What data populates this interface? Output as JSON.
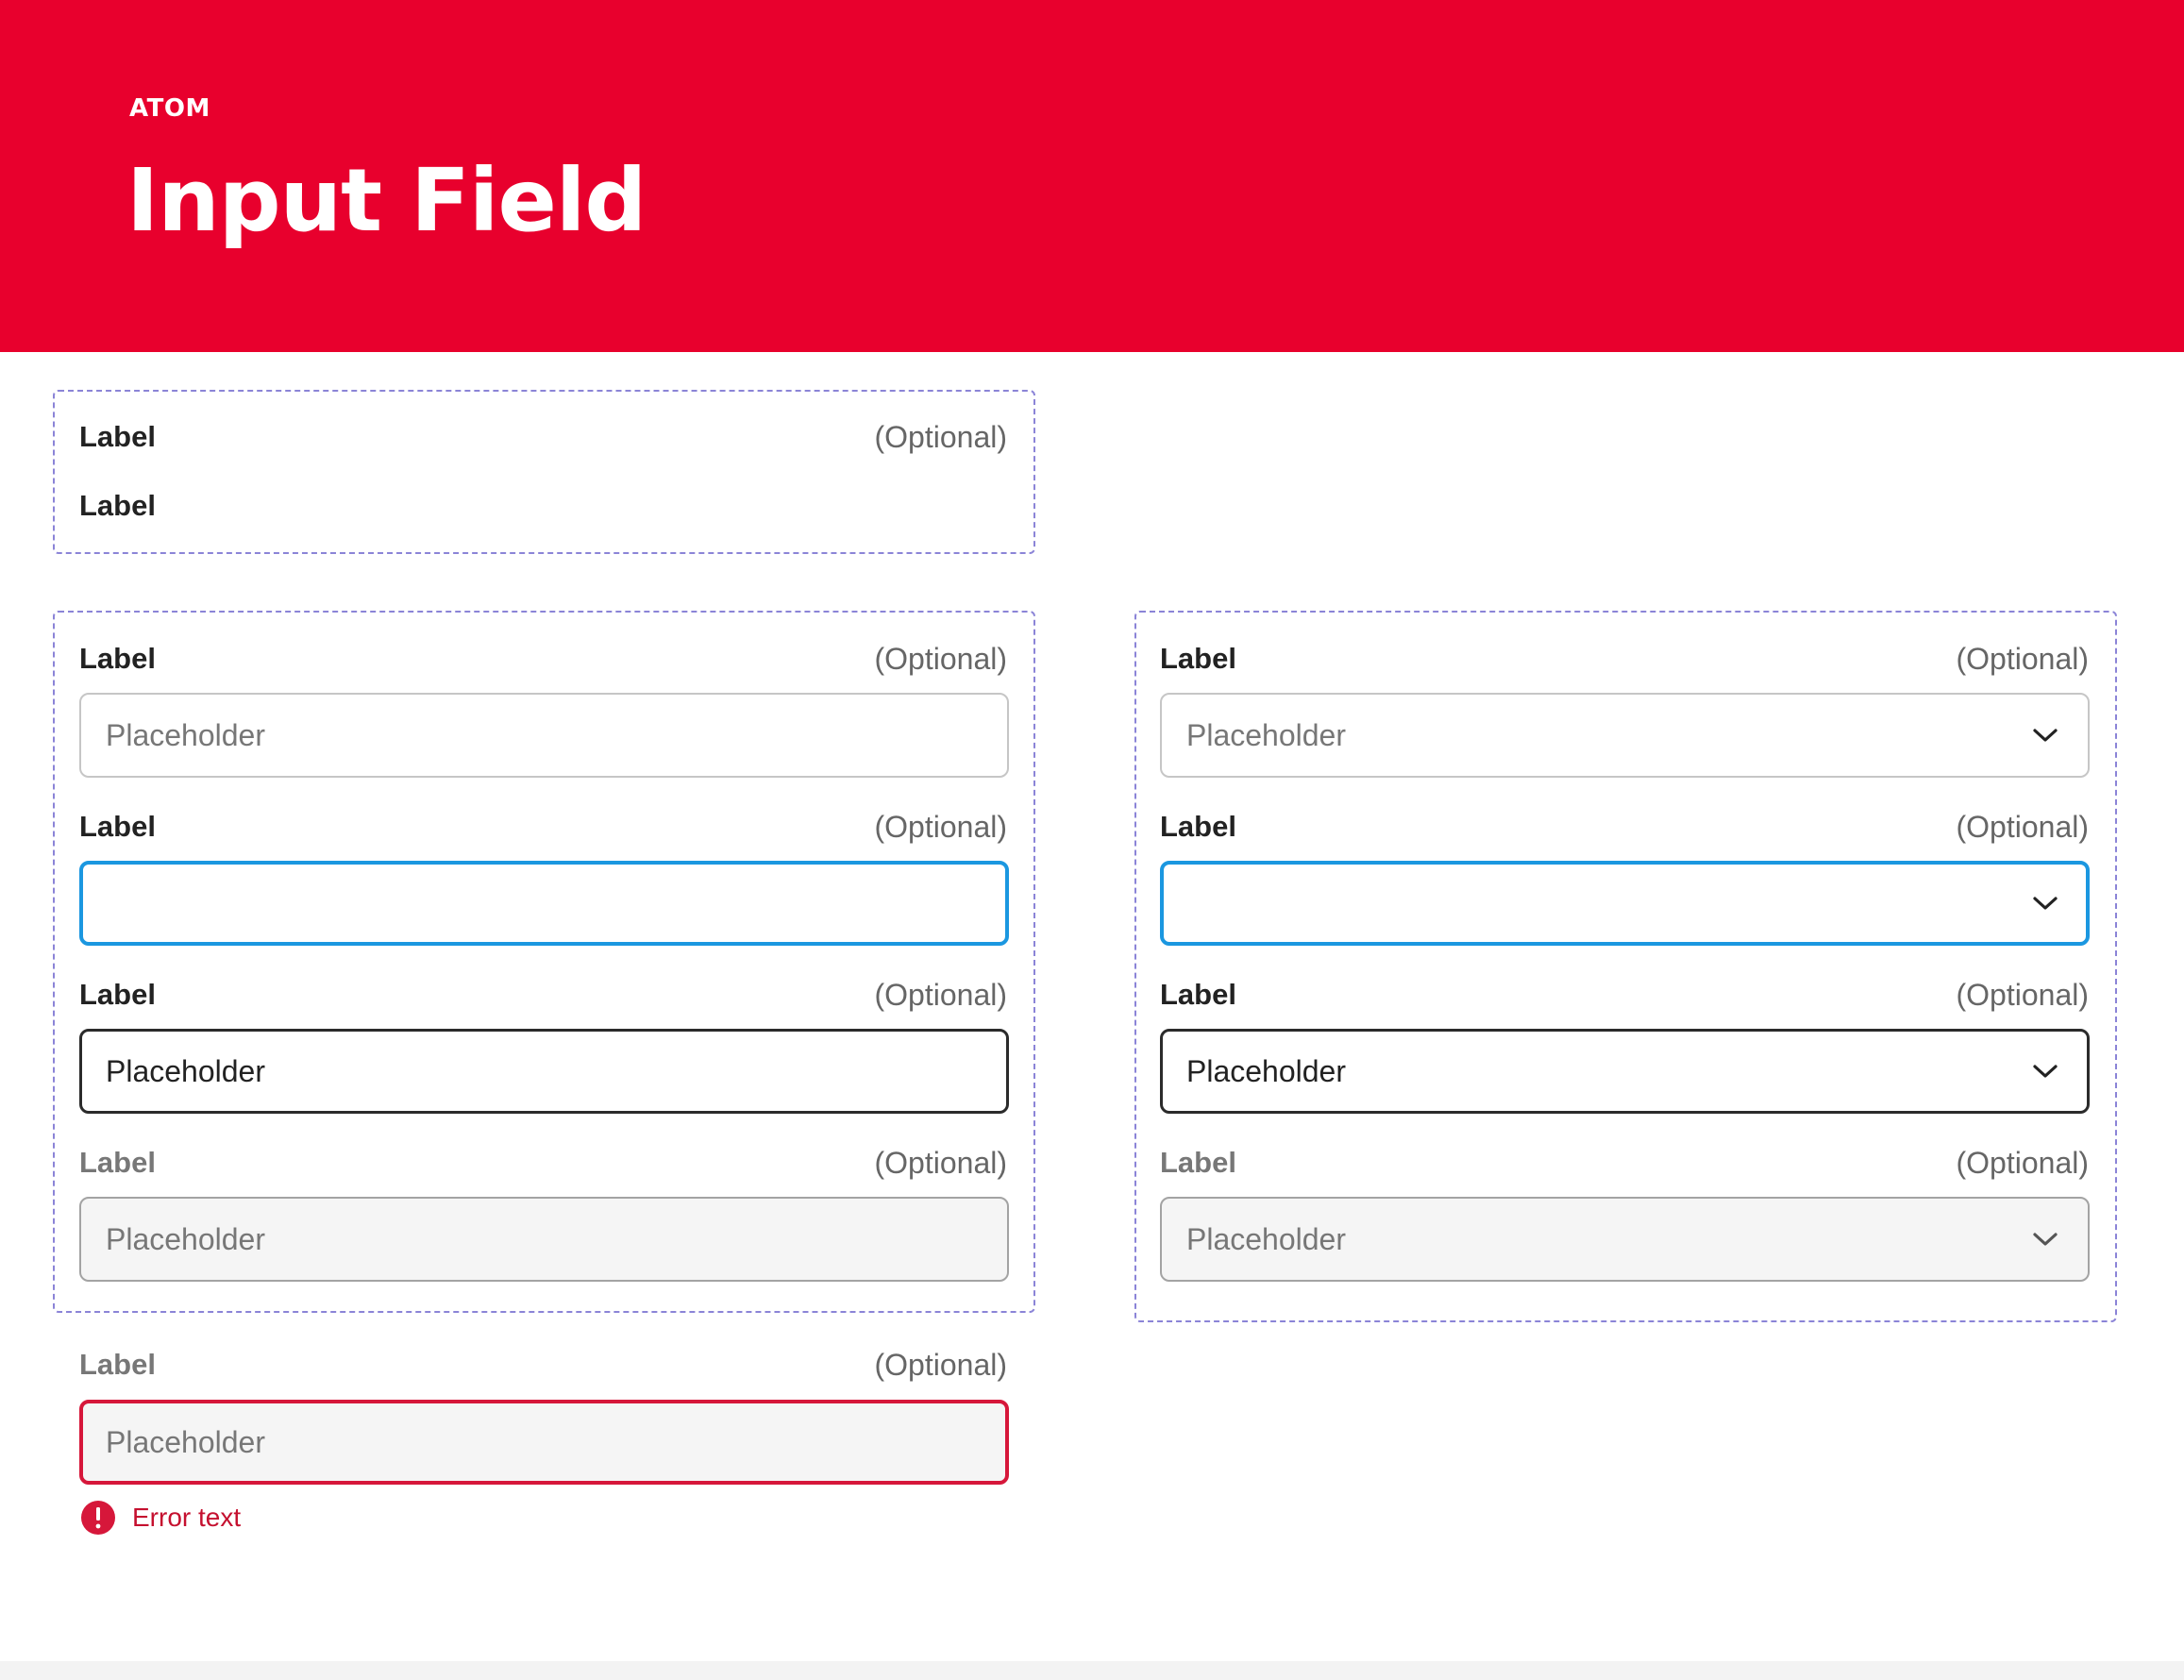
{
  "header": {
    "eyebrow": "ATOM",
    "title": "Input Field",
    "color": "#e8002d"
  },
  "label_spec": {
    "row1": {
      "label": "Label",
      "optional": "(Optional)"
    },
    "row2": {
      "label": "Label"
    }
  },
  "text_inputs": [
    {
      "state": "default",
      "label": "Label",
      "optional": "(Optional)",
      "placeholder": "Placeholder"
    },
    {
      "state": "focused",
      "label": "Label",
      "optional": "(Optional)",
      "placeholder": ""
    },
    {
      "state": "filled",
      "label": "Label",
      "optional": "(Optional)",
      "value": "Placeholder"
    },
    {
      "state": "disabled",
      "label": "Label",
      "optional": "(Optional)",
      "placeholder": "Placeholder"
    }
  ],
  "error_input": {
    "state": "error",
    "label": "Label",
    "optional": "(Optional)",
    "placeholder": "Placeholder",
    "error_text": "Error text",
    "icon": "error-icon",
    "color": "#d6173a"
  },
  "selects": [
    {
      "state": "default",
      "label": "Label",
      "optional": "(Optional)",
      "placeholder": "Placeholder",
      "icon": "chevron-down-icon"
    },
    {
      "state": "focused",
      "label": "Label",
      "optional": "(Optional)",
      "placeholder": "",
      "icon": "chevron-down-icon"
    },
    {
      "state": "filled",
      "label": "Label",
      "optional": "(Optional)",
      "value": "Placeholder",
      "icon": "chevron-down-icon"
    },
    {
      "state": "disabled",
      "label": "Label",
      "optional": "(Optional)",
      "placeholder": "Placeholder",
      "icon": "chevron-down-icon"
    }
  ],
  "colors": {
    "focus": "#1b97e0",
    "filled_border": "#2b2b2b",
    "default_border": "#c6c6c6",
    "disabled_bg": "#f5f5f5",
    "frame_dash": "#8b84d7"
  }
}
